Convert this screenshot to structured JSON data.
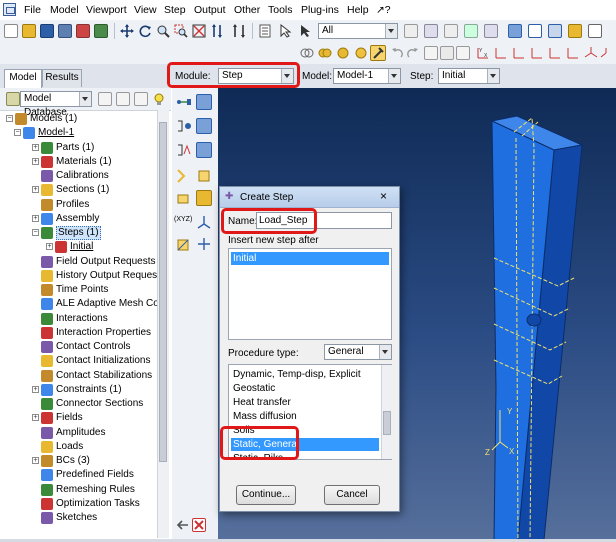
{
  "menubar": {
    "items": [
      "File",
      "Model",
      "Viewport",
      "View",
      "Step",
      "Output",
      "Other",
      "Tools",
      "Plug-ins",
      "Help",
      "↗?"
    ]
  },
  "toolbar": {
    "filter_combo": "All"
  },
  "context_bar": {
    "module_label": "Module:",
    "module_value": "Step",
    "model_label": "Model:",
    "model_value": "Model-1",
    "step_label": "Step:",
    "step_value": "Initial"
  },
  "tabs": [
    "Model",
    "Results"
  ],
  "tree": {
    "database": "Model Database",
    "rows": [
      {
        "label": "Models (1)",
        "level": 0,
        "expander": "-"
      },
      {
        "label": "Model-1",
        "level": 1,
        "expander": "-",
        "underline": true
      },
      {
        "label": "Parts (1)",
        "level": 2,
        "expander": "+"
      },
      {
        "label": "Materials (1)",
        "level": 2,
        "expander": "+"
      },
      {
        "label": "Calibrations",
        "level": 2,
        "expander": ""
      },
      {
        "label": "Sections (1)",
        "level": 2,
        "expander": "+"
      },
      {
        "label": "Profiles",
        "level": 2,
        "expander": ""
      },
      {
        "label": "Assembly",
        "level": 2,
        "expander": "+"
      },
      {
        "label": "Steps (1)",
        "level": 2,
        "expander": "-",
        "highlight": true
      },
      {
        "label": "Initial",
        "level": 3,
        "expander": "+",
        "underline": true
      },
      {
        "label": "Field Output Requests",
        "level": 2,
        "expander": ""
      },
      {
        "label": "History Output Reques",
        "level": 2,
        "expander": ""
      },
      {
        "label": "Time Points",
        "level": 2,
        "expander": ""
      },
      {
        "label": "ALE Adaptive Mesh Cor",
        "level": 2,
        "expander": ""
      },
      {
        "label": "Interactions",
        "level": 2,
        "expander": ""
      },
      {
        "label": "Interaction Properties",
        "level": 2,
        "expander": ""
      },
      {
        "label": "Contact Controls",
        "level": 2,
        "expander": ""
      },
      {
        "label": "Contact Initializations",
        "level": 2,
        "expander": ""
      },
      {
        "label": "Contact Stabilizations",
        "level": 2,
        "expander": ""
      },
      {
        "label": "Constraints (1)",
        "level": 2,
        "expander": "+"
      },
      {
        "label": "Connector Sections",
        "level": 2,
        "expander": ""
      },
      {
        "label": "Fields",
        "level": 2,
        "expander": "+"
      },
      {
        "label": "Amplitudes",
        "level": 2,
        "expander": ""
      },
      {
        "label": "Loads",
        "level": 2,
        "expander": ""
      },
      {
        "label": "BCs (3)",
        "level": 2,
        "expander": "+"
      },
      {
        "label": "Predefined Fields",
        "level": 2,
        "expander": ""
      },
      {
        "label": "Remeshing Rules",
        "level": 2,
        "expander": ""
      },
      {
        "label": "Optimization Tasks",
        "level": 2,
        "expander": ""
      },
      {
        "label": "Sketches",
        "level": 2,
        "expander": ""
      }
    ]
  },
  "toolcol": {
    "xyz_label": "(XYZ)"
  },
  "dialog": {
    "title": "Create Step",
    "name_label": "Name:",
    "name_value": "Load_Step",
    "insert_label": "Insert new step after",
    "insert_items": [
      "Initial"
    ],
    "procedure_label": "Procedure type:",
    "procedure_value": "General",
    "procedures": [
      "Dynamic, Temp-disp, Explicit",
      "Geostatic",
      "Heat transfer",
      "Mass diffusion",
      "Soils",
      "Static, General",
      "Static, Riks"
    ],
    "selected_procedure": "Static, General",
    "continue_label": "Continue...",
    "cancel_label": "Cancel"
  },
  "viewport": {
    "triad_labels": [
      "Y",
      "Z",
      "X"
    ]
  },
  "colors": {
    "highlight_red": "#e01818",
    "selection_blue": "#3399ff",
    "part_blue": "#1f6fe0",
    "viewport_top": "#0f2a55"
  }
}
